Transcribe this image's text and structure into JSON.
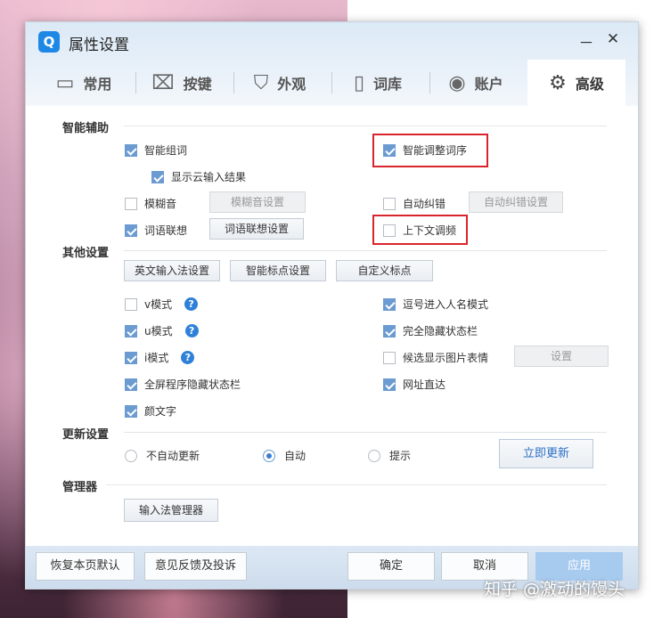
{
  "window": {
    "title": "属性设置",
    "logo_letter": "Q",
    "minimize": "－",
    "close": "✕"
  },
  "tabs": [
    {
      "label": "常用",
      "icon": "monitor-icon",
      "glyph": "▭"
    },
    {
      "label": "按键",
      "icon": "keyboard-key-icon",
      "glyph": "⌧"
    },
    {
      "label": "外观",
      "icon": "tshirt-icon",
      "glyph": "⛉"
    },
    {
      "label": "词库",
      "icon": "book-icon",
      "glyph": "▯"
    },
    {
      "label": "账户",
      "icon": "user-account-icon",
      "glyph": "◉"
    },
    {
      "label": "高级",
      "icon": "gear-icon",
      "glyph": "⚙",
      "active": true
    }
  ],
  "sections": {
    "smart_assist": {
      "title": "智能辅助",
      "smart_word": {
        "label": "智能组词",
        "checked": true
      },
      "show_cloud": {
        "label": "显示云输入结果",
        "checked": true
      },
      "smart_adjust": {
        "label": "智能调整词序",
        "checked": true
      },
      "fuzzy": {
        "label": "模糊音",
        "checked": false,
        "button": "模糊音设置"
      },
      "autocorrect": {
        "label": "自动纠错",
        "checked": false,
        "button": "自动纠错设置"
      },
      "association": {
        "label": "词语联想",
        "checked": true,
        "button": "词语联想设置"
      },
      "context_freq": {
        "label": "上下文调频",
        "checked": false
      }
    },
    "other": {
      "title": "其他设置",
      "buttons": [
        "英文输入法设置",
        "智能标点设置",
        "自定义标点"
      ],
      "v_mode": {
        "label": "v模式",
        "checked": false,
        "help": "?"
      },
      "u_mode": {
        "label": "u模式",
        "checked": true,
        "help": "?"
      },
      "i_mode": {
        "label": "i模式",
        "checked": true,
        "help": "?"
      },
      "fullscreen_hide": {
        "label": "全屏程序隐藏状态栏",
        "checked": true
      },
      "emoticon": {
        "label": "颜文字",
        "checked": true
      },
      "comma_name": {
        "label": "逗号进入人名模式",
        "checked": true
      },
      "hide_statusbar": {
        "label": "完全隐藏状态栏",
        "checked": true
      },
      "candidate_image": {
        "label": "候选显示图片表情",
        "checked": false,
        "button": "设置"
      },
      "url_direct": {
        "label": "网址直达",
        "checked": true
      }
    },
    "update": {
      "title": "更新设置",
      "options": [
        {
          "label": "不自动更新",
          "selected": false
        },
        {
          "label": "自动",
          "selected": true
        },
        {
          "label": "提示",
          "selected": false
        }
      ],
      "update_now": "立即更新"
    },
    "manager": {
      "title": "管理器",
      "button": "输入法管理器"
    }
  },
  "footer": {
    "restore": "恢复本页默认",
    "feedback": "意见反馈及投诉",
    "ok": "确定",
    "cancel": "取消",
    "apply": "应用"
  },
  "watermark": "知乎 @激动的馒头",
  "colors": {
    "accent": "#2f80d8",
    "checkbox": "#6b9bd1",
    "highlight": "#d8252c"
  }
}
